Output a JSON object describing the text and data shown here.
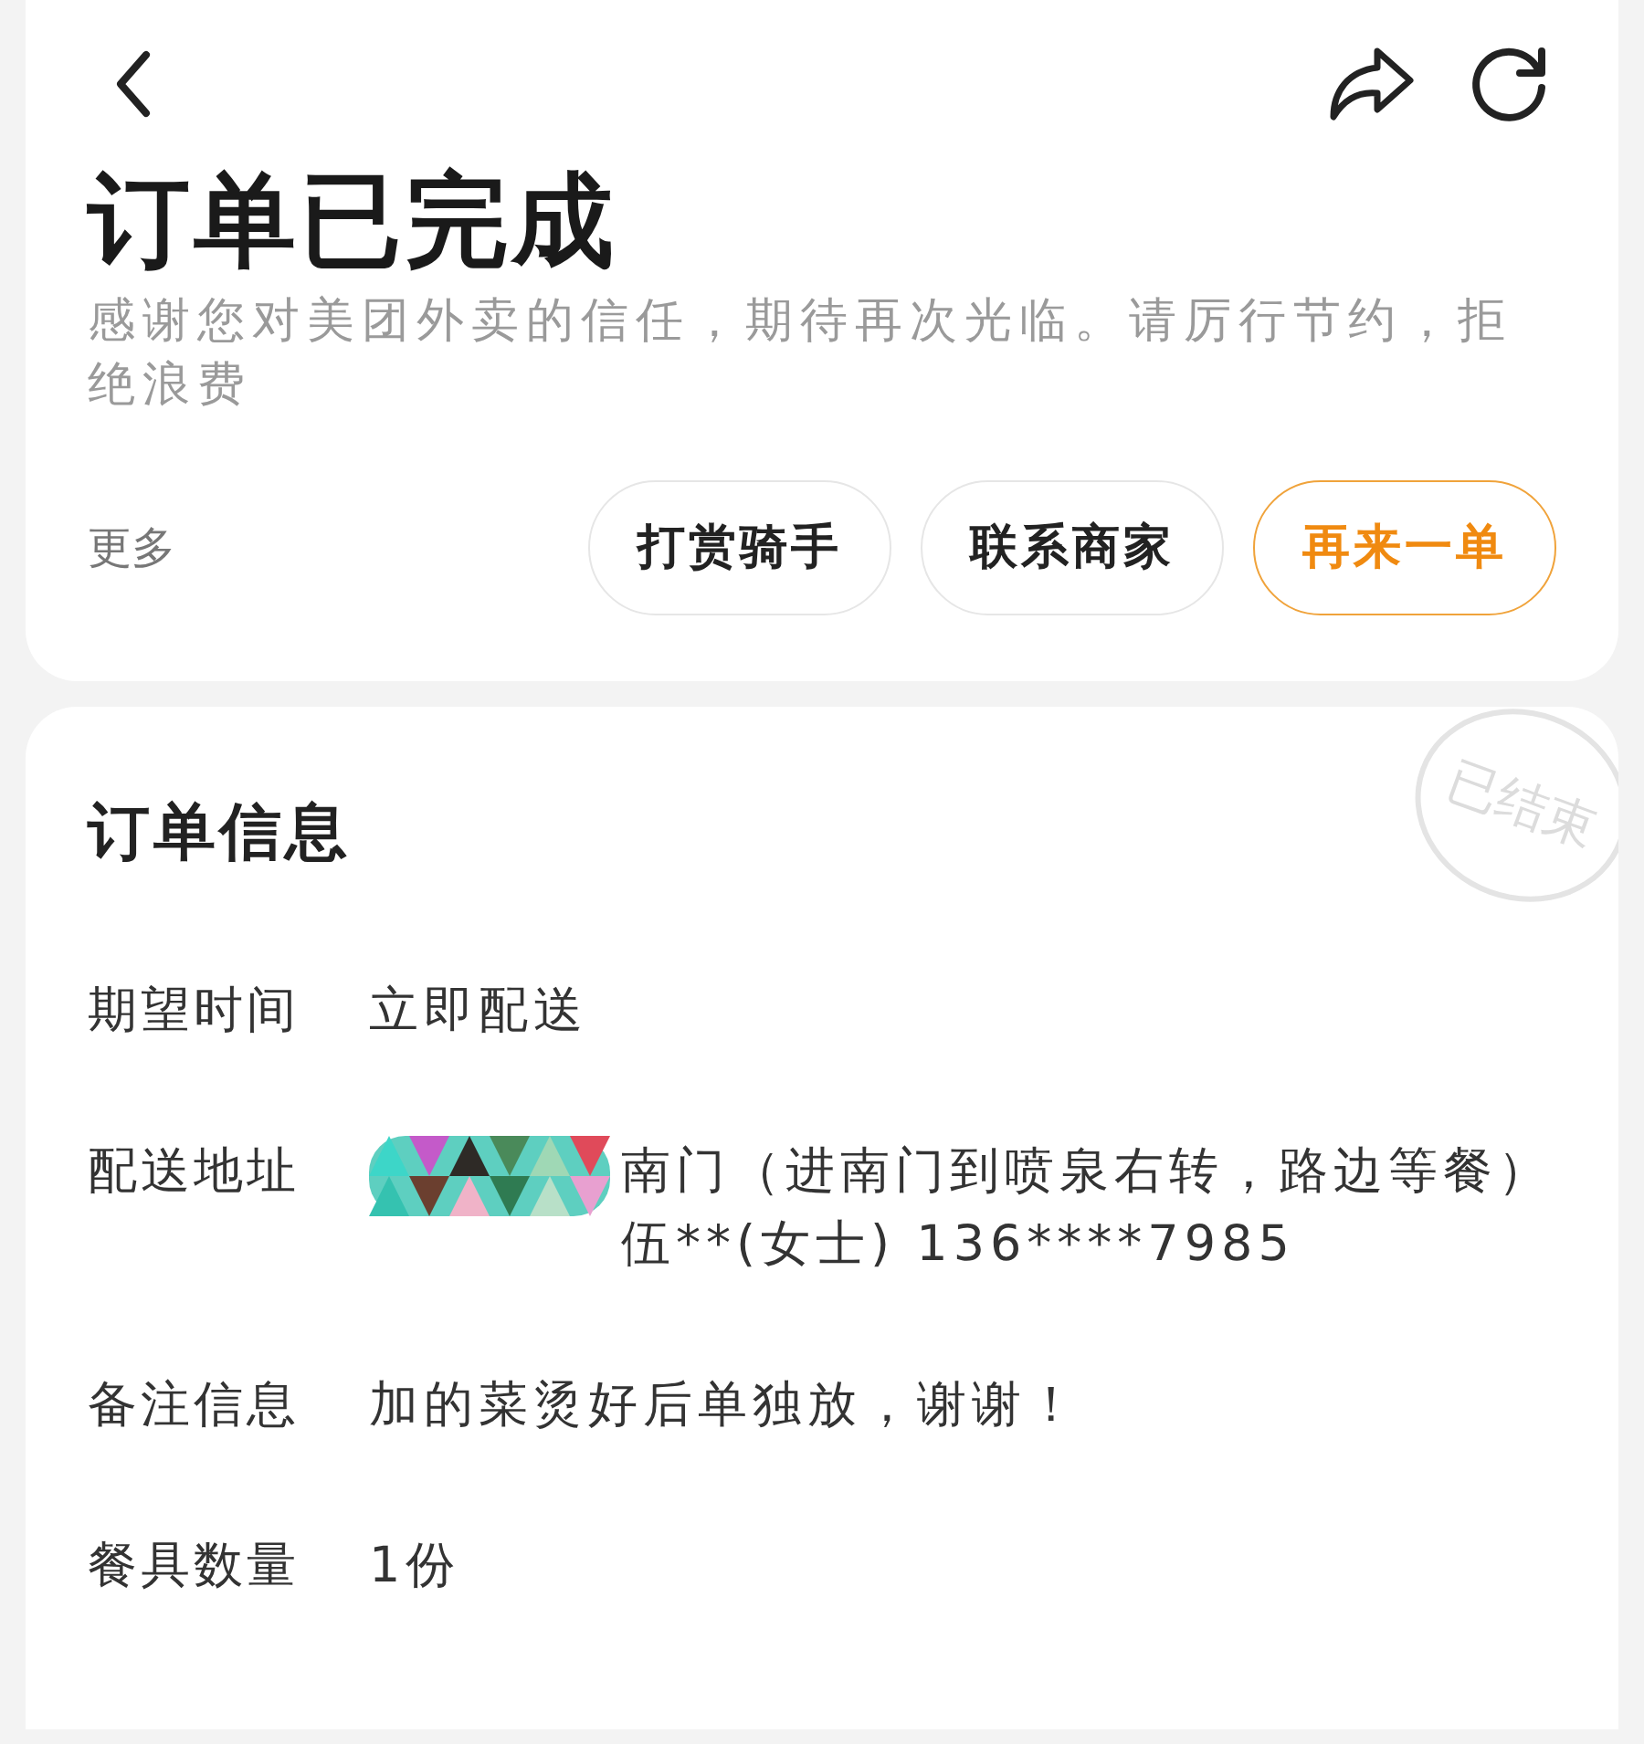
{
  "header": {
    "title": "订单已完成",
    "subtitle": "感谢您对美团外卖的信任，期待再次光临。请厉行节约，拒绝浪费"
  },
  "actions": {
    "more": "更多",
    "buttons": [
      {
        "label": "打赏骑手",
        "primary": false
      },
      {
        "label": "联系商家",
        "primary": false
      },
      {
        "label": "再来一单",
        "primary": true
      }
    ]
  },
  "order_info": {
    "title": "订单信息",
    "stamp": "已结束",
    "rows": [
      {
        "label": "期望时间",
        "lines": [
          "立即配送"
        ]
      },
      {
        "label": "配送地址",
        "redacted": true,
        "lines": [
          "南门（进南门到喷泉右转，路边等餐）",
          "伍**(女士) 136****7985"
        ]
      },
      {
        "label": "备注信息",
        "lines": [
          "加的菜烫好后单独放，谢谢！"
        ]
      },
      {
        "label": "餐具数量",
        "lines": [
          "1份"
        ]
      }
    ]
  }
}
